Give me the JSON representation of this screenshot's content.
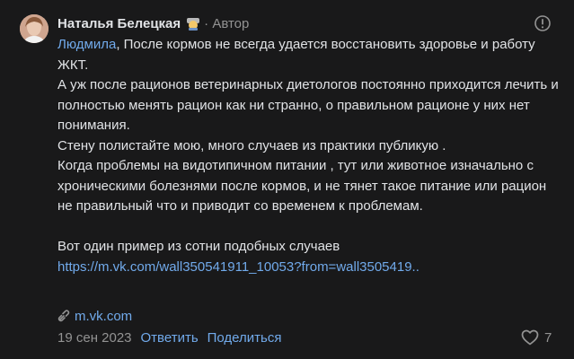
{
  "comment": {
    "author": {
      "name": "Наталья Белецкая",
      "role": "· Автор"
    },
    "mention": "Людмила",
    "paragraphs": [
      ", После кормов не всегда удается восстановить здоровье и работу ЖКТ.",
      "А уж после рационов ветеринарных диетологов постоянно приходится лечить и полностью менять рацион как ни странно, о правильном рационе у них нет понимания.",
      "Стену полистайте мою, много случаев из практики публикую .",
      "Когда проблемы на видотипичном питании , тут или животное изначально с хроническими болезнями после кормов, и не тянет такое питание или рацион не правильный что и приводит со временем к проблемам."
    ],
    "example_text": "Вот один пример из сотни подобных случаев",
    "link_text": "https://m.vk.com/wall350541911_10053?from=wall3505419..",
    "attachment": "m.vk.com",
    "date": "19 сен 2023",
    "reply_label": "Ответить",
    "share_label": "Поделиться",
    "likes_count": "7"
  },
  "colors": {
    "background": "#19191a",
    "text": "#e1e3e6",
    "link": "#71aaeb",
    "muted": "#939393"
  },
  "icons": {
    "report": "report-icon",
    "attachment": "link-icon",
    "like": "heart-icon"
  }
}
